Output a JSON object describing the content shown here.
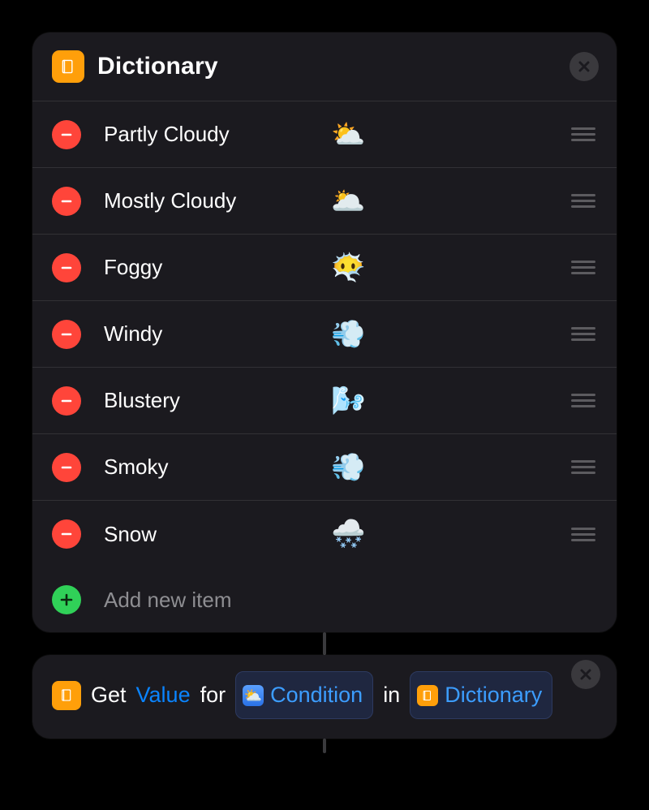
{
  "dictionary": {
    "title": "Dictionary",
    "icon": "dictionary-icon",
    "items": [
      {
        "key": "Partly Cloudy",
        "value": "⛅"
      },
      {
        "key": "Mostly Cloudy",
        "value": "🌥️"
      },
      {
        "key": "Foggy",
        "value": "😶‍🌫️"
      },
      {
        "key": "Windy",
        "value": "💨"
      },
      {
        "key": "Blustery",
        "value": "🌬️"
      },
      {
        "key": "Smoky",
        "value": "💨"
      },
      {
        "key": "Snow",
        "value": "🌨️"
      }
    ],
    "add_label": "Add new item"
  },
  "get_value": {
    "icon": "dictionary-icon",
    "word_get": "Get",
    "value_label": "Value",
    "word_for": "for",
    "condition_label": "Condition",
    "word_in": "in",
    "dict_label": "Dictionary"
  }
}
